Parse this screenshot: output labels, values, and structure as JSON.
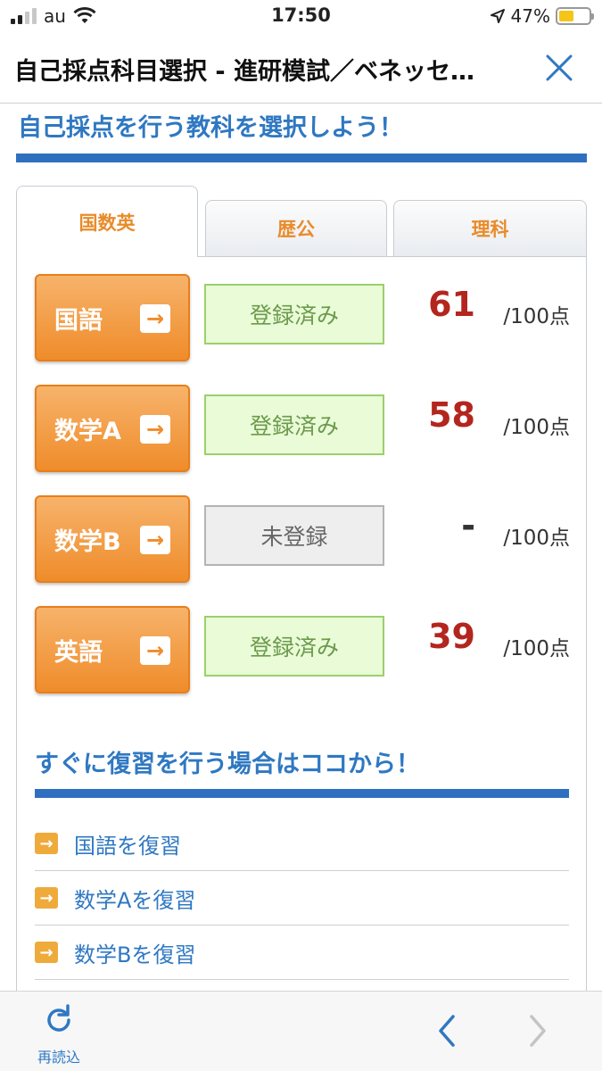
{
  "status_bar": {
    "carrier": "au",
    "time": "17:50",
    "battery": "47%"
  },
  "nav": {
    "title": "自己採点科目選択 - 進研模試／ベネッセ…"
  },
  "main": {
    "heading": "自己採点を行う教科を選択しよう！",
    "tabs": [
      {
        "label": "国数英",
        "active": true
      },
      {
        "label": "歴公"
      },
      {
        "label": "理科"
      }
    ],
    "subjects": [
      {
        "name": "国語",
        "status": "登録済み",
        "score": "61",
        "max": "/100点"
      },
      {
        "name": "数学A",
        "status": "登録済み",
        "score": "58",
        "max": "/100点"
      },
      {
        "name": "数学B",
        "status": "未登録",
        "score": "-",
        "max": "/100点"
      },
      {
        "name": "英語",
        "status": "登録済み",
        "score": "39",
        "max": "/100点"
      }
    ],
    "review_heading": "すぐに復習を行う場合はココから！",
    "review_links": [
      {
        "label": "国語を復習"
      },
      {
        "label": "数学Aを復習"
      },
      {
        "label": "数学Bを復習"
      }
    ]
  },
  "toolbar": {
    "reload_label": "再読込"
  },
  "colors": {
    "accent_blue": "#2f78c2",
    "button_orange": "#ef8c2b",
    "score_red": "#b3261e",
    "registered_green": "#e9fbd7"
  }
}
